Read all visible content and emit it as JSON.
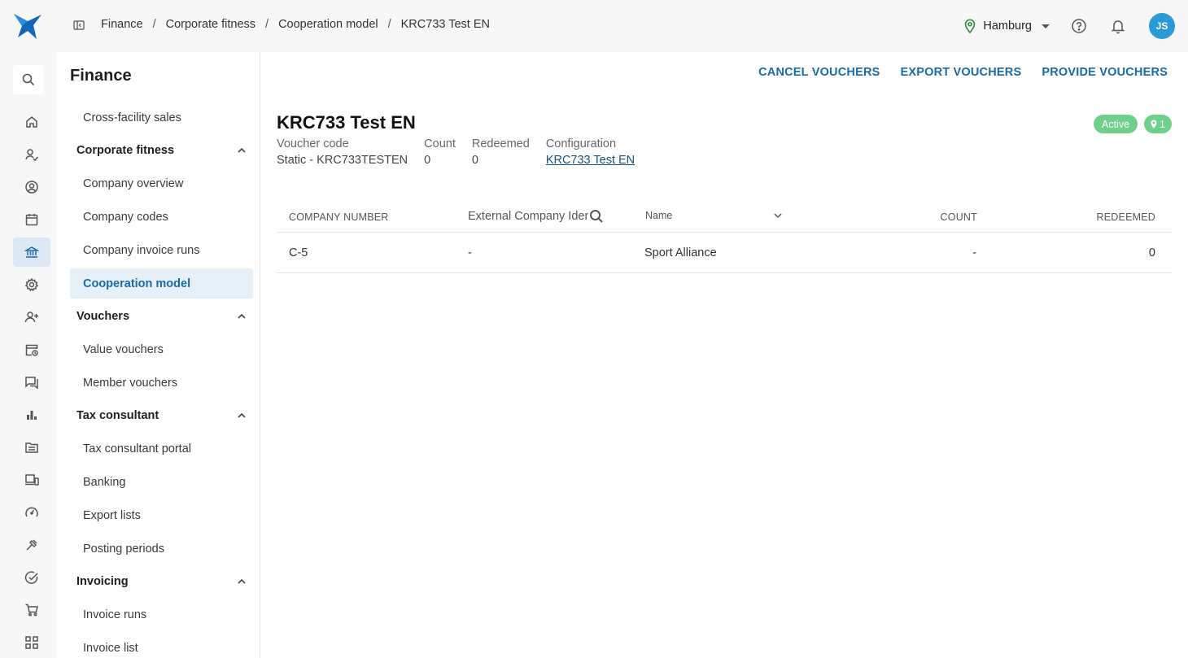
{
  "header": {
    "breadcrumb": [
      "Finance",
      "Corporate fitness",
      "Cooperation model",
      "KRC733 Test EN"
    ],
    "location": "Hamburg",
    "avatar_initials": "JS"
  },
  "sidebar": {
    "title": "Finance",
    "items": {
      "cross_facility_sales": "Cross-facility sales",
      "corporate_fitness": "Corporate fitness",
      "company_overview": "Company overview",
      "company_codes": "Company codes",
      "company_invoice_runs": "Company invoice runs",
      "cooperation_model": "Cooperation model",
      "vouchers": "Vouchers",
      "value_vouchers": "Value vouchers",
      "member_vouchers": "Member vouchers",
      "tax_consultant": "Tax consultant",
      "tax_consultant_portal": "Tax consultant portal",
      "banking": "Banking",
      "export_lists": "Export lists",
      "posting_periods": "Posting periods",
      "invoicing": "Invoicing",
      "invoice_runs": "Invoice runs",
      "invoice_list": "Invoice list"
    }
  },
  "actions": {
    "cancel": "CANCEL VOUCHERS",
    "export": "EXPORT VOUCHERS",
    "provide": "PROVIDE VOUCHERS"
  },
  "detail": {
    "title": "KRC733 Test EN",
    "status": "Active",
    "location_count": "1",
    "voucher_code_label": "Voucher code",
    "voucher_code_value": "Static - KRC733TESTEN",
    "count_label": "Count",
    "count_value": "0",
    "redeemed_label": "Redeemed",
    "redeemed_value": "0",
    "configuration_label": "Configuration",
    "configuration_value": "KRC733 Test EN"
  },
  "table": {
    "col_company_number": "COMPANY NUMBER",
    "col_external_placeholder": "External Company Identifier",
    "col_name": "Name",
    "col_count": "COUNT",
    "col_redeemed": "REDEEMED",
    "rows": [
      {
        "company_number": "C-5",
        "external_id": "-",
        "name": "Sport Alliance",
        "count": "-",
        "redeemed": "0"
      }
    ]
  },
  "colors": {
    "accent": "#1a6aa8",
    "active_badge": "#6fd08c",
    "avatar": "#2b9bd8"
  }
}
